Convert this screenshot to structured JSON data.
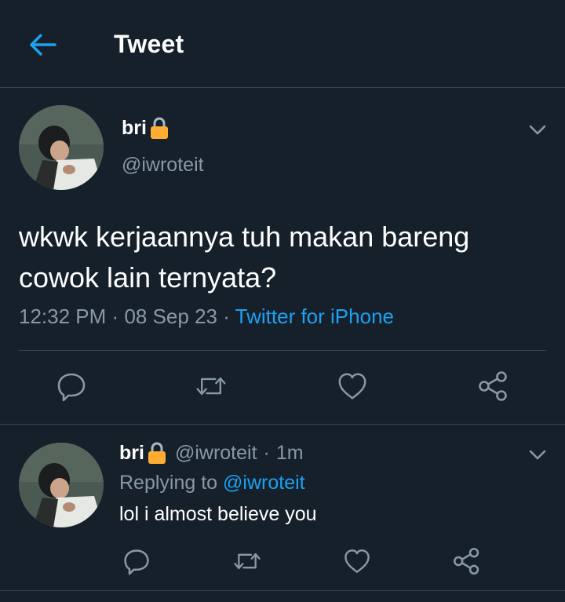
{
  "topbar": {
    "title": "Tweet",
    "back_icon": "arrow-left-icon",
    "accent": "#1da1f2"
  },
  "tweet": {
    "author_name": "bri",
    "author_badge_icon": "lock-icon",
    "author_handle": "@iwroteit",
    "text": "wkwk kerjaannya tuh makan bareng cowok lain ternyata?",
    "time": "12:32 PM",
    "separator": "·",
    "date": "08 Sep 23",
    "source": "Twitter for iPhone",
    "actions": [
      "reply-icon",
      "retweet-icon",
      "like-icon",
      "share-icon"
    ]
  },
  "reply": {
    "author_name": "bri",
    "author_badge_icon": "lock-icon",
    "author_handle": "@iwroteit",
    "separator": "·",
    "age": "1m",
    "replying_prefix": "Replying to",
    "replying_to": "@iwroteit",
    "text": "lol i almost believe you",
    "actions": [
      "reply-icon",
      "retweet-icon",
      "like-icon",
      "share-icon"
    ]
  },
  "colors": {
    "background": "#15202b",
    "divider": "#38444d",
    "secondary_text": "#8899a6",
    "link": "#1da1f2",
    "lock": "#ffad1f"
  }
}
